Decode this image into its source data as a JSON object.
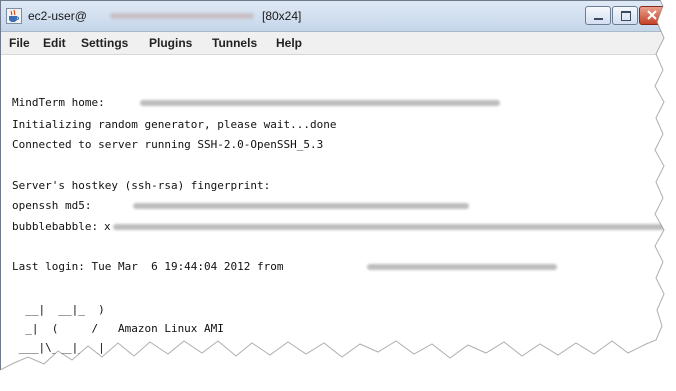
{
  "window": {
    "title_prefix": "ec2-user@",
    "title_suffix": " [80x24]"
  },
  "menu": [
    "File",
    "Edit",
    "Settings",
    "Plugins",
    "Tunnels",
    "Help"
  ],
  "terminal": {
    "home_label": "MindTerm home:",
    "init": "Initializing random generator, please wait...done",
    "connected": "Connected to server running SSH-2.0-OpenSSH_5.3",
    "hostkey": "Server's hostkey (ssh-rsa) fingerprint:",
    "md5_label": "openssh md5:",
    "bubble_label": "bubblebabble:",
    "bubble_char": "x",
    "last_login": "Last login: Tue Mar  6 19:44:04 2012 from",
    "ami_art_1": "  __|  __|_  )",
    "ami_art_2": "  _|  (     /   Amazon Linux AMI",
    "ami_art_3": " ___|\\___|___|"
  },
  "icons": {
    "app": "java-cup-icon",
    "minimize": "minimize-icon",
    "maximize": "maximize-icon",
    "close": "close-icon"
  },
  "colors": {
    "titlebar": "#c5d6ea",
    "close": "#c5432a",
    "terminal_bg": "#ffffff",
    "text": "#111111"
  }
}
